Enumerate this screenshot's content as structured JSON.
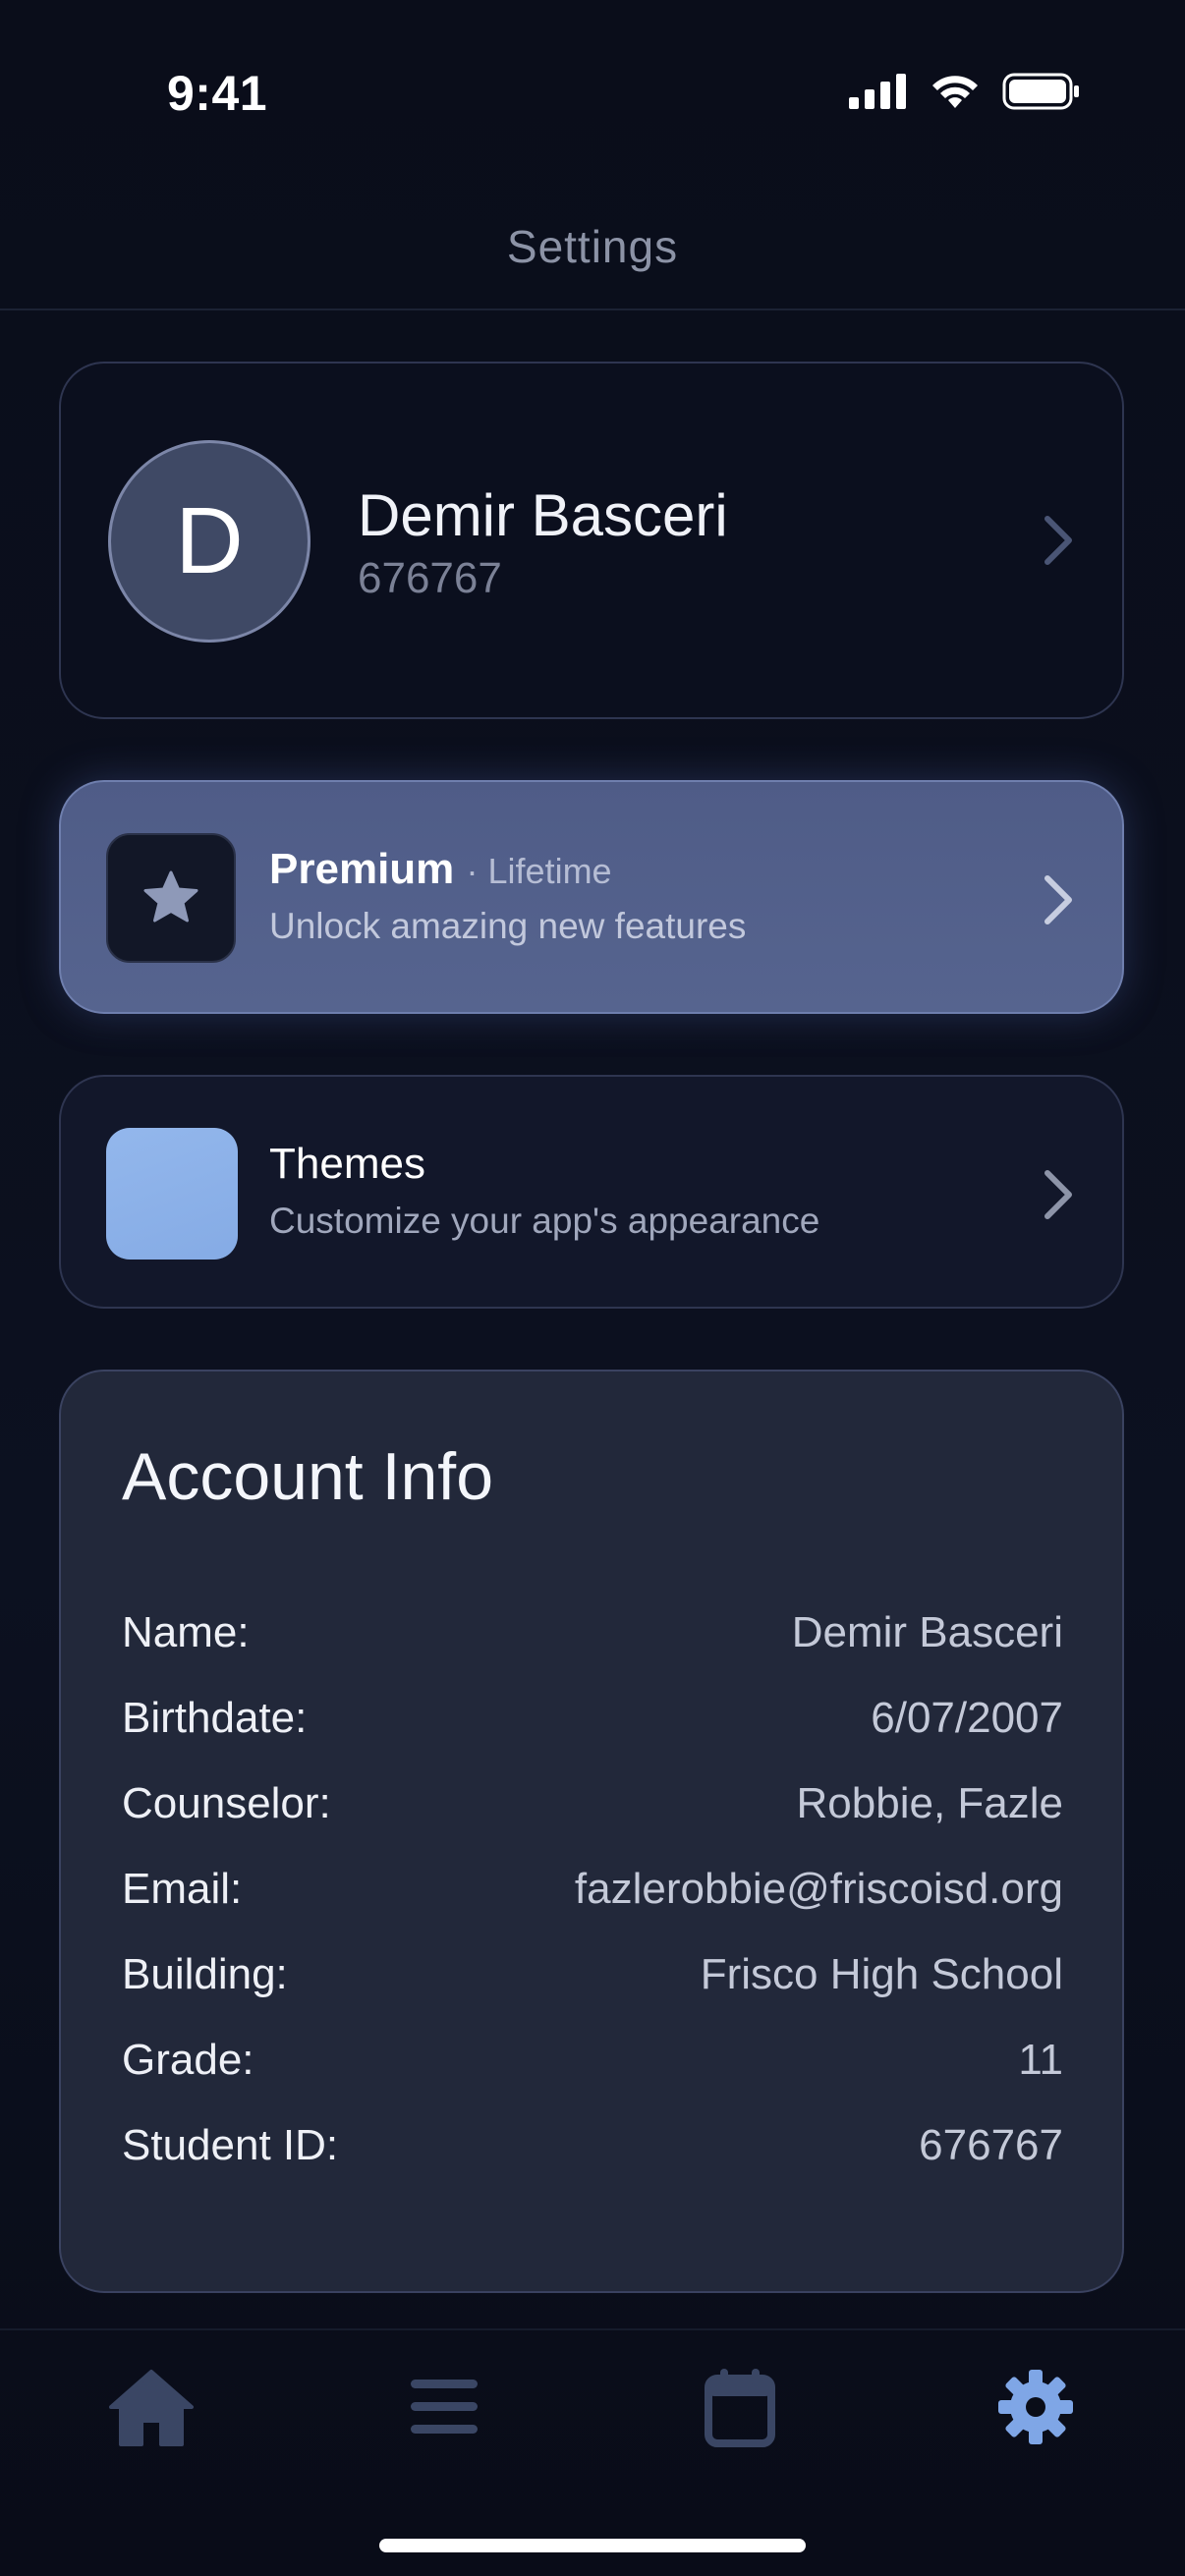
{
  "status_bar": {
    "time": "9:41"
  },
  "header": {
    "title": "Settings"
  },
  "profile": {
    "initial": "D",
    "name": "Demir Basceri",
    "id": "676767"
  },
  "premium": {
    "title": "Premium",
    "tag": "· Lifetime",
    "subtitle": "Unlock amazing new features",
    "icon": "star-icon"
  },
  "themes": {
    "title": "Themes",
    "subtitle": "Customize your app's appearance",
    "swatch_color": "#8db2ea"
  },
  "account_info": {
    "title": "Account Info",
    "rows": [
      {
        "label": "Name:",
        "value": "Demir Basceri"
      },
      {
        "label": "Birthdate:",
        "value": "6/07/2007"
      },
      {
        "label": "Counselor:",
        "value": "Robbie, Fazle"
      },
      {
        "label": "Email:",
        "value": "fazlerobbie@friscoisd.org"
      },
      {
        "label": "Building:",
        "value": "Frisco High School"
      },
      {
        "label": "Grade:",
        "value": "11"
      },
      {
        "label": "Student ID:",
        "value": "676767"
      }
    ]
  },
  "tab_bar": {
    "tabs": [
      {
        "icon": "home-icon",
        "active": false
      },
      {
        "icon": "menu-icon",
        "active": false
      },
      {
        "icon": "calendar-icon",
        "active": false
      },
      {
        "icon": "gear-icon",
        "active": true
      }
    ],
    "active_color": "#7fa6e6",
    "inactive_color": "#3a4664"
  }
}
